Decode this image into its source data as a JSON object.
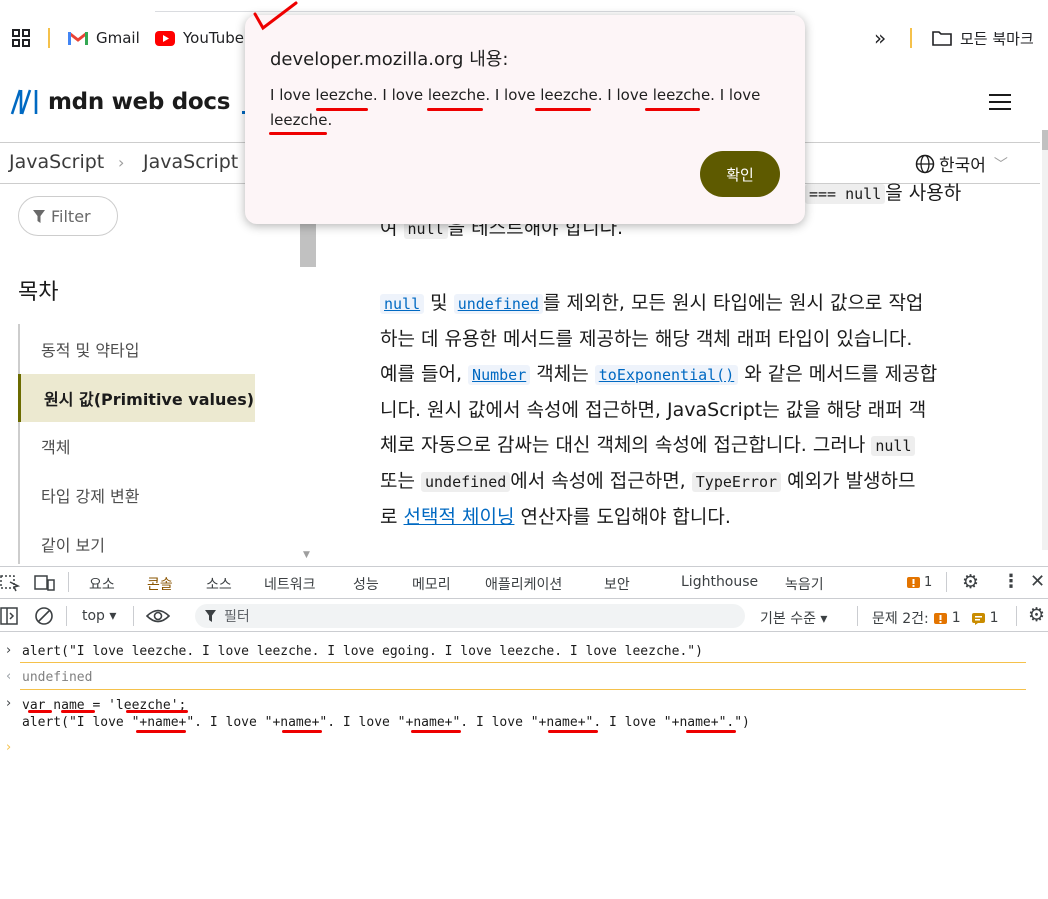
{
  "bookmarks": {
    "items": [
      {
        "label": "Gmail",
        "icon": "gmail-icon"
      },
      {
        "label": "YouTube",
        "icon": "youtube-icon"
      }
    ],
    "all_bookmarks": "모든 북마크",
    "overflow": "»"
  },
  "mdn": {
    "logo": "mdn web docs",
    "breadcrumb": [
      "JavaScript",
      "JavaScript"
    ],
    "language": "한국어"
  },
  "sidebar": {
    "filter_placeholder": "Filter",
    "toc_title": "목차",
    "toc_items": [
      {
        "label": "동적 및 약타입",
        "active": false
      },
      {
        "label": "원시 값(Primitive values)",
        "active": true
      },
      {
        "label": "객체",
        "active": false
      },
      {
        "label": "타입 강제 변환",
        "active": false
      },
      {
        "label": "같이 보기",
        "active": false
      }
    ]
  },
  "article": {
    "p0_tail_code": "=== null",
    "p0_tail_text": "을 사용하",
    "p0_line2_pre": "여 ",
    "p0_line2_code": "null",
    "p0_line2_post": "을 테스트해야 합니다.",
    "p1": {
      "null": "null",
      "and": " 및 ",
      "undefined": "undefined",
      "t1": "를 제외한, 모든 원시 타입에는 원시 값으로 작업",
      "t2": "하는 데 유용한 메서드를 제공하는 해당 객체 래퍼 타입이 있습니다.",
      "t3a": "예를 들어, ",
      "number": "Number",
      "t3b": " 객체는 ",
      "toexp": "toExponential()",
      "t3c": " 와 같은 메서드를 제공합",
      "t4": "니다. 원시 값에서 속성에 접근하면, JavaScript는 값을 해당 래퍼 객",
      "t5": "체로 자동으로 감싸는 대신 객체의 속성에 접근합니다. 그러나 ",
      "null2": "null",
      "t6a": "또는 ",
      "undefined2": "undefined",
      "t6b": "에서 속성에 접근하면, ",
      "typeerror": "TypeError",
      "t6c": " 예외가 발생하므",
      "t7a": "로 ",
      "optional": "선택적 체이닝",
      "t7b": " 연산자를 도입해야 합니다."
    }
  },
  "dialog": {
    "title": "developer.mozilla.org 내용:",
    "message": "I love leezche. I love leezche. I love leezche. I love leezche. I love leezche.",
    "ok": "확인"
  },
  "devtools": {
    "tabs": [
      "요소",
      "콘솔",
      "소스",
      "네트워크",
      "성능",
      "메모리",
      "애플리케이션",
      "보안",
      "Lighthouse",
      "녹음기"
    ],
    "active_tab": "콘솔",
    "issue_badge": "1",
    "context": "top ▾",
    "filter_placeholder": "필터",
    "level": "기본 수준 ▾",
    "issues_label": "문제 2건:",
    "issues_a": "1",
    "issues_b": "1",
    "console": {
      "line1": "alert(\"I love leezche. I love leezche. I love egoing. I love leezche. I love leezche.\")",
      "result1": "undefined",
      "line2": "var name = 'leezche';",
      "line3": "alert(\"I love \"+name+\". I love \"+name+\". I love \"+name+\". I love \"+name+\". I love \"+name+\".\")"
    }
  },
  "colors": {
    "accent": "#0069c2",
    "dialog_button": "#5e5a00",
    "active_toc": "#ece9d0",
    "annotation": "#e00000"
  }
}
